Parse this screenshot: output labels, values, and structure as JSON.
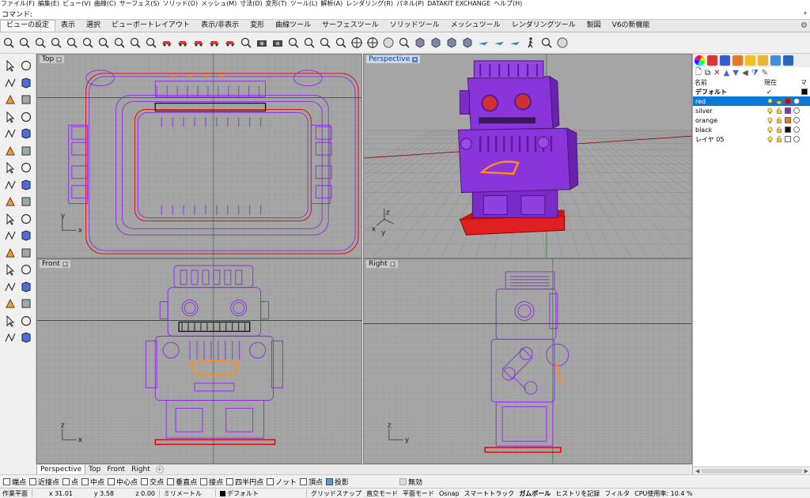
{
  "menubar": [
    "ファイル(F)",
    "編集(E)",
    "ビュー(V)",
    "曲線(C)",
    "サーフェス(S)",
    "ソリッド(O)",
    "メッシュ(M)",
    "寸法(D)",
    "変形(T)",
    "ツール(L)",
    "解析(A)",
    "レンダリング(R)",
    "パネル(P)",
    "DATAKIT EXCHANGE",
    "ヘルプ(H)"
  ],
  "command": {
    "label": "コマンド:",
    "value": ""
  },
  "tabs": [
    "ビューの設定",
    "表示",
    "選択",
    "ビューポートレイアウト",
    "表示/非表示",
    "変形",
    "曲線ツール",
    "サーフェスツール",
    "ソリッドツール",
    "メッシュツール",
    "レンダリングツール",
    "製図",
    "V6の新機能"
  ],
  "active_tab": "ビューの設定",
  "viewports": {
    "top": {
      "label": "Top",
      "axis_a": "y",
      "axis_b": "x"
    },
    "perspective": {
      "label": "Perspective",
      "axis_a": "z",
      "axis_b": "y",
      "axis_c": "x"
    },
    "front": {
      "label": "Front",
      "axis_a": "z",
      "axis_b": "x"
    },
    "right": {
      "label": "Right",
      "axis_a": "z",
      "axis_b": "y"
    }
  },
  "viewport_tabs": [
    "Perspective",
    "Top",
    "Front",
    "Right"
  ],
  "active_viewport_tab": "Perspective",
  "layers_panel": {
    "col_name": "名前",
    "col_current": "現在",
    "col_mat": "マ",
    "default_layer": "デフォルト",
    "check": "✓",
    "layers": [
      {
        "name": "red",
        "color": "#d40000",
        "selected": true
      },
      {
        "name": "silver",
        "color": "#8b2fc9",
        "selected": false
      },
      {
        "name": "orange",
        "color": "#f08000",
        "selected": false
      },
      {
        "name": "black",
        "color": "#111111",
        "selected": false
      },
      {
        "name": "レイヤ 05",
        "color": "#ffffff",
        "selected": false
      }
    ]
  },
  "osnap": [
    {
      "label": "端点",
      "checked": false
    },
    {
      "label": "近接点",
      "checked": false
    },
    {
      "label": "点",
      "checked": false
    },
    {
      "label": "中点",
      "checked": false
    },
    {
      "label": "中心点",
      "checked": false
    },
    {
      "label": "交点",
      "checked": false
    },
    {
      "label": "垂直点",
      "checked": false
    },
    {
      "label": "接点",
      "checked": false
    },
    {
      "label": "四半円点",
      "checked": false
    },
    {
      "label": "ノット",
      "checked": false
    },
    {
      "label": "頂点",
      "checked": false
    },
    {
      "label": "投影",
      "checked": true
    },
    {
      "label": "無効",
      "checked": false,
      "disabled": true
    }
  ],
  "status": {
    "cplane": "作業平面",
    "x": "x 31.01",
    "y": "y 3.58",
    "z": "z 0.00",
    "units": "ミリメートル",
    "layer": "デフォルト",
    "grid_snap": "グリッドスナップ",
    "ortho": "直交モード",
    "planar": "平面モード",
    "osnap": "Osnap",
    "smarttrack": "スマートトラック",
    "gumball": "ガムボール",
    "history": "ヒストリを記録",
    "filter": "フィルタ",
    "cpu": "CPU使用率: 10.4 %"
  },
  "colors": {
    "purple": "#8a2be2",
    "red": "#e00000",
    "orange": "#ff8c1a",
    "viewport_bg": "#a5a5a5"
  }
}
